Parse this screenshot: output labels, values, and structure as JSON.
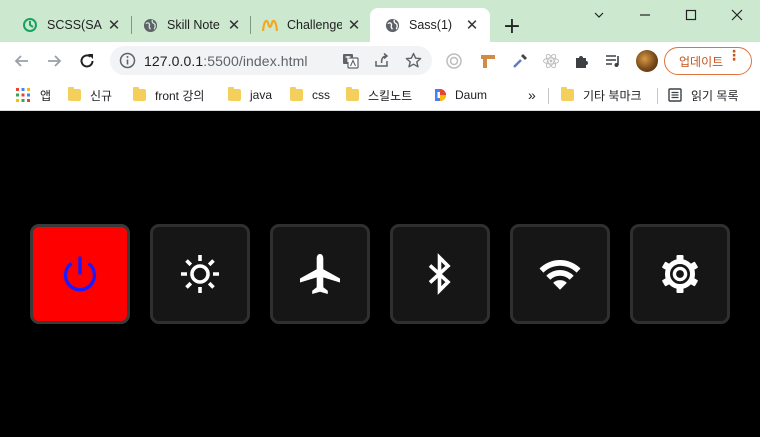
{
  "browser": {
    "tabs": [
      {
        "title": "SCSS(SASS",
        "icon": "green-refresh-favicon-icon",
        "close": "✕"
      },
      {
        "title": "Skill Note",
        "icon": "globe-icon",
        "close": "✕"
      },
      {
        "title": "Challenge",
        "icon": "mcdonalds-logo-icon",
        "close": "✕"
      },
      {
        "title": "Sass(1)",
        "icon": "globe-icon",
        "close": "✕",
        "active": true
      }
    ],
    "new_tab": "+",
    "address": {
      "host": "127.0.0.1",
      "rest": ":5500/index.html"
    },
    "update_label": "업데이트",
    "update_menu": "⋮",
    "bookmarks": [
      {
        "label": "앱",
        "icon": "apps-grid-icon"
      },
      {
        "label": "신규",
        "icon": "folder-icon"
      },
      {
        "label": "front 강의",
        "icon": "folder-icon"
      },
      {
        "label": "java",
        "icon": "folder-icon"
      },
      {
        "label": "css",
        "icon": "folder-icon"
      },
      {
        "label": "스킬노트",
        "icon": "folder-icon"
      },
      {
        "label": "Daum",
        "icon": "daum-logo-icon"
      }
    ],
    "bookmarks_more": "»",
    "other_bookmarks": "기타 북마크",
    "reading_list": "읽기 목록"
  },
  "colors": {
    "tab_bar": "#cce8cf",
    "page_background": "#000000",
    "button_background": "#161616",
    "button_border": "#2f2f2f",
    "active_button": "#ff0000",
    "power_icon": "#1a1aff",
    "icon_white": "#ffffff",
    "update_accent": "#e0743c"
  },
  "quick_settings": [
    {
      "name": "power",
      "icon": "power-icon",
      "active": true
    },
    {
      "name": "brightness",
      "icon": "sun-icon",
      "active": false
    },
    {
      "name": "airplane-mode",
      "icon": "airplane-icon",
      "active": false
    },
    {
      "name": "bluetooth",
      "icon": "bluetooth-icon",
      "active": false
    },
    {
      "name": "wifi",
      "icon": "wifi-icon",
      "active": false
    },
    {
      "name": "settings",
      "icon": "gear-icon",
      "active": false
    }
  ]
}
